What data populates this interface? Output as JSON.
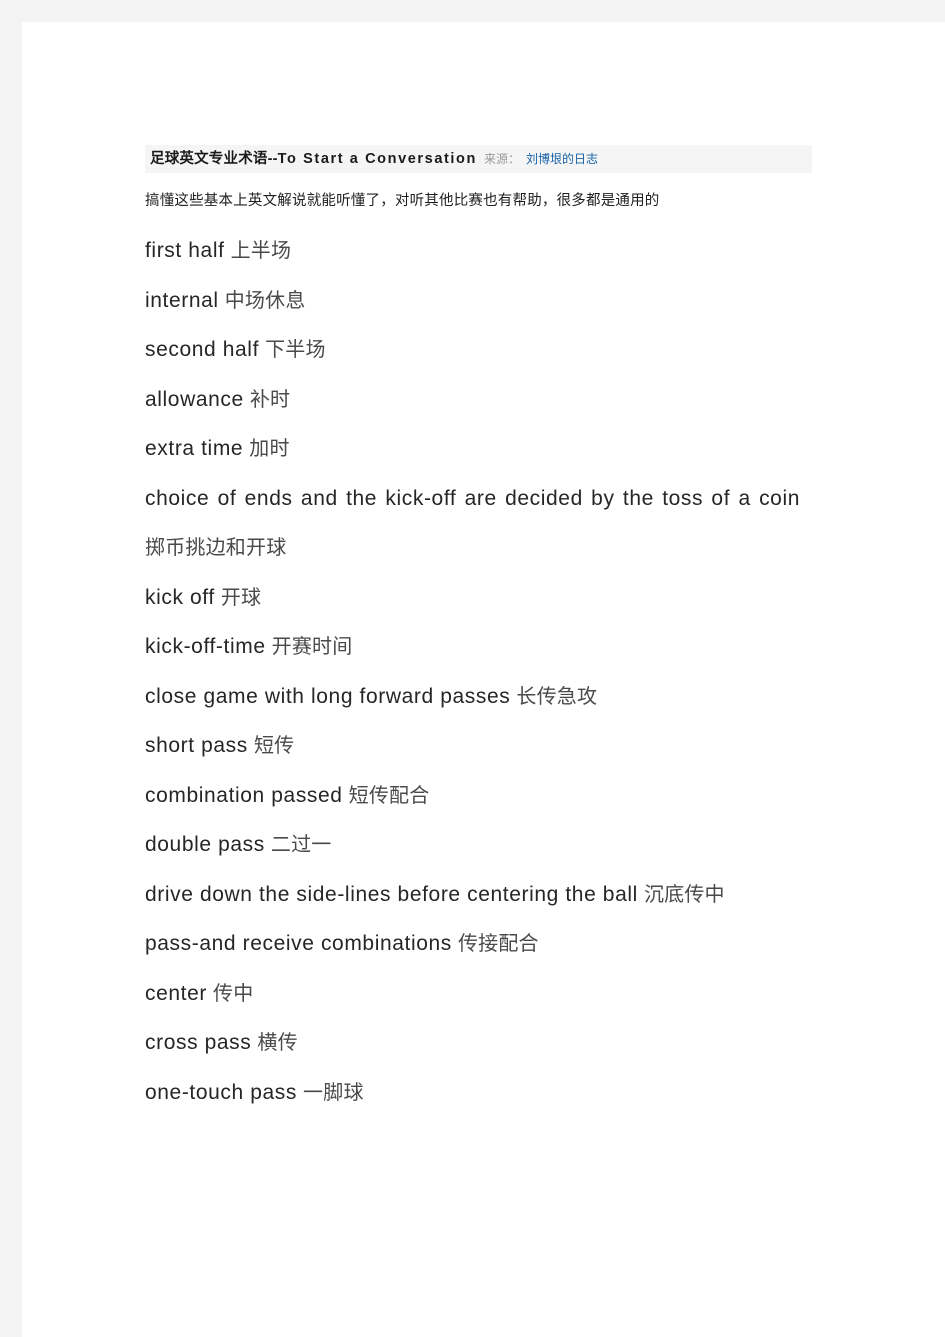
{
  "page": {
    "background_color": "#ffffff",
    "frame_color": "#f3f3f3"
  },
  "header": {
    "title_zh": "足球英文专业术语",
    "title_separator": "--",
    "title_en": "To Start a Conversation",
    "source_label": "来源：",
    "source_link": "刘博垠的日志",
    "bar_color": "#f5f5f5",
    "link_color": "#1762a8"
  },
  "intro": {
    "text": "搞懂这些基本上英文解说就能听懂了，对听其他比赛也有帮助，很多都是通用的"
  },
  "terms": [
    {
      "en": "first  half",
      "cn": "上半场",
      "justify": false
    },
    {
      "en": "internal",
      "cn": "中场休息",
      "justify": false
    },
    {
      "en": "second  half",
      "cn": "下半场",
      "justify": false
    },
    {
      "en": "allowance",
      "cn": "补时",
      "justify": false
    },
    {
      "en": "extra  time",
      "cn": "加时",
      "justify": false
    },
    {
      "en": "choice of ends and the kick-off are decided by the toss of a coin",
      "cn": "掷币挑边和开球",
      "justify": true
    },
    {
      "en": "kick  off",
      "cn": "开球",
      "justify": false
    },
    {
      "en": "kick-off-time",
      "cn": "开赛时间",
      "justify": false
    },
    {
      "en": "close  game  with  long  forward  passes",
      "cn": "长传急攻",
      "justify": false
    },
    {
      "en": "short  pass",
      "cn": "短传",
      "justify": false
    },
    {
      "en": "combination  passed",
      "cn": "短传配合",
      "justify": false
    },
    {
      "en": "double  pass",
      "cn": "二过一",
      "justify": false
    },
    {
      "en": "drive down the side-lines before centering the ball",
      "cn": "沉底传中",
      "justify": true
    },
    {
      "en": "pass-and  receive  combinations",
      "cn": "传接配合",
      "justify": false
    },
    {
      "en": "center",
      "cn": "传中",
      "justify": false
    },
    {
      "en": "cross  pass",
      "cn": "横传",
      "justify": false
    },
    {
      "en": "one-touch  pass",
      "cn": "一脚球",
      "justify": false
    }
  ]
}
